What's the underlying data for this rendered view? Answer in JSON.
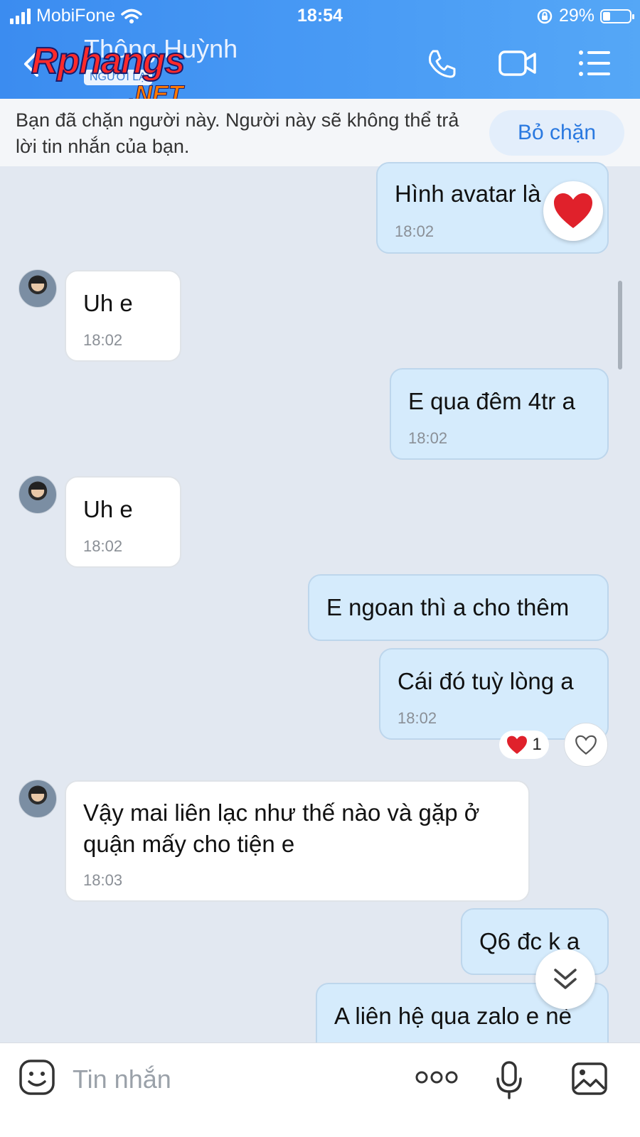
{
  "status_bar": {
    "carrier": "MobiFone",
    "time": "18:54",
    "battery_percent": "29%",
    "battery_level": 0.29
  },
  "header": {
    "contact_name": "Thông Huỳnh",
    "stranger_badge": "NGƯỜI LẠ",
    "watermark_main": "Rphangs",
    "watermark_sub": ".NET",
    "icons": [
      "back-icon",
      "phone-icon",
      "video-call-icon",
      "menu-icon"
    ],
    "accent_color": "#4a9cf5"
  },
  "banner": {
    "text": "Bạn đã chặn người này. Người này sẽ không thể trả lời tin nhắn của bạn.",
    "unblock_label": "Bỏ chặn"
  },
  "messages": [
    {
      "dir": "out",
      "text": "Hình avatar là",
      "time": "18:02",
      "reaction": "heart"
    },
    {
      "dir": "in",
      "text": "Uh e",
      "time": "18:02"
    },
    {
      "dir": "out",
      "text": "E qua đêm 4tr a",
      "time": "18:02"
    },
    {
      "dir": "in",
      "text": "Uh e",
      "time": "18:02"
    },
    {
      "dir": "out",
      "text": "E ngoan thì a cho thêm",
      "time": ""
    },
    {
      "dir": "out",
      "text": "Cái đó tuỳ lòng a",
      "time": "18:02",
      "reaction_count": "1"
    },
    {
      "dir": "in",
      "text": "Vậy mai liên lạc như thế nào và gặp ở quận mấy cho tiện e",
      "time": "18:03"
    },
    {
      "dir": "out",
      "text": "Q6 đc k a",
      "time": ""
    },
    {
      "dir": "out",
      "text": "A liên hệ qua zalo e nè",
      "time": ""
    }
  ],
  "composer": {
    "placeholder": "Tin nhắn",
    "icons": [
      "sticker-icon",
      "more-icon",
      "microphone-icon",
      "image-icon"
    ]
  }
}
